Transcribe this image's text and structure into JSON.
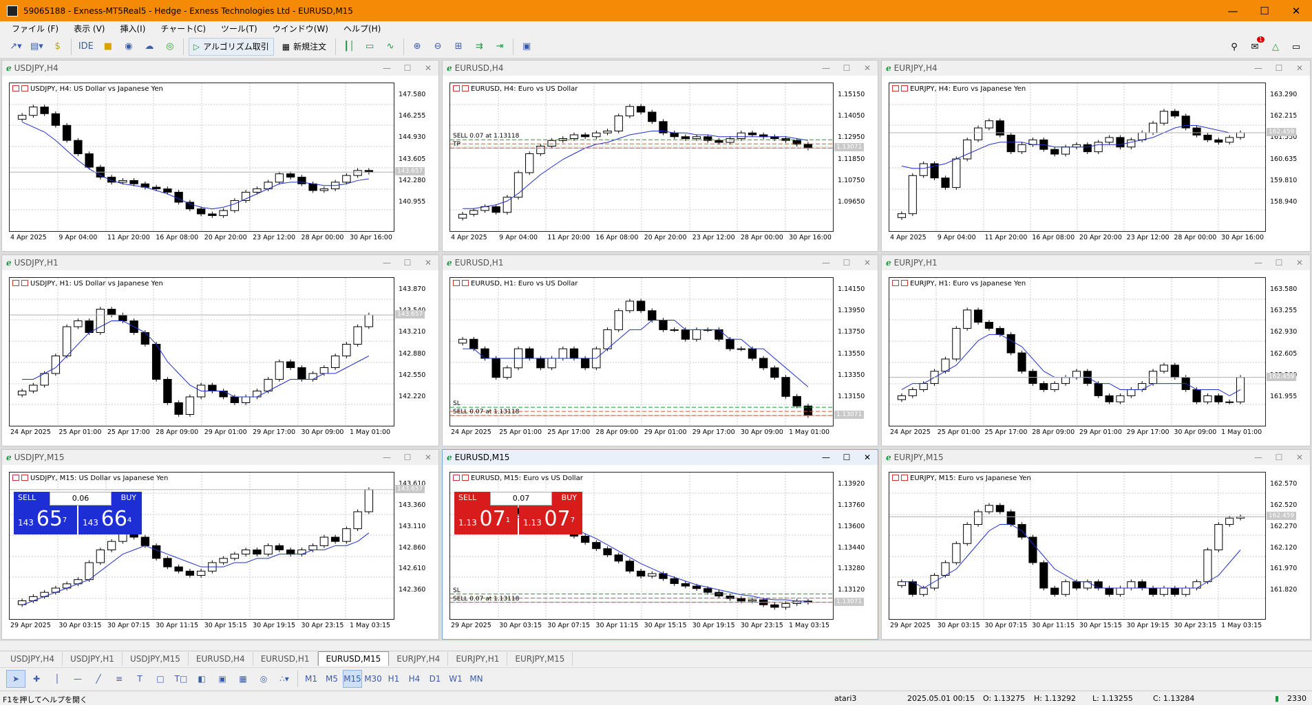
{
  "app": {
    "title": "59065188 - Exness-MT5Real5 - Hedge - Exness Technologies Ltd - EURUSD,M15"
  },
  "menu": [
    "ファイル (F)",
    "表示 (V)",
    "挿入(I)",
    "チャート(C)",
    "ツール(T)",
    "ウインドウ(W)",
    "ヘルプ(H)"
  ],
  "toolbar": {
    "ide": "IDE",
    "algo": "アルゴリズム取引",
    "new_order": "新規注文",
    "badge": "1"
  },
  "charts": [
    {
      "id": "usdjpy-h4",
      "title": "USDJPY,H4",
      "label": "USDJPY, H4:  US Dollar vs Japanese Yen",
      "y": [
        "147.580",
        "146.255",
        "144.930",
        "143.605",
        "142.280",
        "140.955"
      ],
      "x": [
        "4 Apr 2025",
        "9 Apr 04:00",
        "11 Apr 20:00",
        "16 Apr 08:00",
        "20 Apr 20:00",
        "23 Apr 12:00",
        "28 Apr 00:00",
        "30 Apr 16:00"
      ],
      "tag": "143.657",
      "close": [
        146.9,
        147.4,
        147.0,
        146.3,
        145.4,
        144.6,
        143.8,
        143.2,
        142.9,
        143.0,
        142.8,
        142.6,
        142.5,
        142.3,
        141.7,
        141.3,
        141.0,
        140.9,
        141.2,
        141.8,
        142.3,
        142.5,
        142.9,
        143.4,
        143.2,
        142.8,
        142.4,
        142.5,
        142.9,
        143.3,
        143.6,
        143.5
      ],
      "ma": [
        146.5,
        146.2,
        145.9,
        145.4,
        144.8,
        144.2,
        143.7,
        143.3,
        143.0,
        142.8,
        142.7,
        142.6,
        142.4,
        142.2,
        141.9,
        141.6,
        141.4,
        141.3,
        141.4,
        141.6,
        141.9,
        142.2,
        142.5,
        142.8,
        142.9,
        142.9,
        142.8,
        142.7,
        142.7,
        142.8,
        143.0,
        143.1
      ],
      "ymin": 140.3,
      "ymax": 148.0
    },
    {
      "id": "eurusd-h4",
      "title": "EURUSD,H4",
      "label": "EURUSD, H4:  Euro vs US Dollar",
      "y": [
        "1.15150",
        "1.14050",
        "1.12950",
        "1.11850",
        "1.10750",
        "1.09650"
      ],
      "x": [
        "4 Apr 2025",
        "9 Apr 04:00",
        "11 Apr 20:00",
        "16 Apr 08:00",
        "20 Apr 20:00",
        "23 Apr 12:00",
        "28 Apr 00:00",
        "30 Apr 16:00"
      ],
      "tag": "1.13071",
      "trades": [
        "SELL 0.07 at 1.13118",
        "TP"
      ],
      "close": [
        1.096,
        1.098,
        1.1,
        1.097,
        1.105,
        1.118,
        1.128,
        1.132,
        1.135,
        1.136,
        1.138,
        1.137,
        1.139,
        1.14,
        1.148,
        1.153,
        1.15,
        1.145,
        1.139,
        1.137,
        1.136,
        1.137,
        1.135,
        1.134,
        1.136,
        1.139,
        1.138,
        1.137,
        1.136,
        1.135,
        1.133,
        1.131
      ],
      "ma": [
        1.099,
        1.099,
        1.1,
        1.101,
        1.103,
        1.107,
        1.112,
        1.117,
        1.121,
        1.125,
        1.128,
        1.131,
        1.133,
        1.134,
        1.136,
        1.138,
        1.139,
        1.14,
        1.14,
        1.139,
        1.139,
        1.138,
        1.138,
        1.137,
        1.137,
        1.137,
        1.137,
        1.137,
        1.137,
        1.137,
        1.136,
        1.135
      ],
      "ymin": 1.09,
      "ymax": 1.158
    },
    {
      "id": "eurjpy-h4",
      "title": "EURJPY,H4",
      "label": "EURJPY, H4:  Euro vs Japanese Yen",
      "y": [
        "163.290",
        "162.215",
        "161.550",
        "160.635",
        "159.810",
        "158.940"
      ],
      "x": [
        "4 Apr 2025",
        "9 Apr 04:00",
        "11 Apr 20:00",
        "16 Apr 08:00",
        "20 Apr 20:00",
        "23 Apr 12:00",
        "28 Apr 00:00",
        "30 Apr 16:00"
      ],
      "tag": "162.459",
      "close": [
        158.9,
        160.5,
        161.0,
        160.4,
        160.0,
        161.2,
        162.0,
        162.5,
        162.8,
        162.2,
        161.5,
        161.8,
        162.0,
        161.6,
        161.4,
        161.7,
        161.8,
        161.5,
        161.9,
        162.1,
        161.7,
        162.0,
        162.3,
        162.7,
        163.2,
        163.0,
        162.5,
        162.2,
        162.0,
        161.9,
        162.1,
        162.3
      ],
      "ma": [
        160.9,
        160.8,
        160.8,
        160.9,
        161.0,
        161.2,
        161.4,
        161.6,
        161.8,
        161.9,
        161.9,
        161.9,
        161.8,
        161.8,
        161.7,
        161.7,
        161.7,
        161.7,
        161.8,
        161.8,
        161.8,
        161.9,
        162.0,
        162.1,
        162.3,
        162.5,
        162.6,
        162.6,
        162.5,
        162.4,
        162.3,
        162.3
      ],
      "ymin": 158.4,
      "ymax": 163.8
    },
    {
      "id": "usdjpy-h1",
      "title": "USDJPY,H1",
      "label": "USDJPY, H1:  US Dollar vs Japanese Yen",
      "y": [
        "143.870",
        "143.540",
        "143.210",
        "142.880",
        "142.550",
        "142.220"
      ],
      "x": [
        "24 Apr 2025",
        "25 Apr 01:00",
        "25 Apr 17:00",
        "28 Apr 09:00",
        "29 Apr 01:00",
        "29 Apr 17:00",
        "30 Apr 09:00",
        "1 May 01:00"
      ],
      "tag": "143.657",
      "close": [
        142.4,
        142.5,
        142.7,
        143.0,
        143.5,
        143.6,
        143.4,
        143.8,
        143.7,
        143.6,
        143.4,
        143.2,
        142.6,
        142.2,
        142.0,
        142.3,
        142.5,
        142.4,
        142.3,
        142.2,
        142.3,
        142.4,
        142.6,
        142.9,
        142.8,
        142.6,
        142.7,
        142.8,
        143.0,
        143.2,
        143.5,
        143.7
      ],
      "ma": [
        142.6,
        142.6,
        142.7,
        142.8,
        143.0,
        143.2,
        143.4,
        143.5,
        143.6,
        143.6,
        143.5,
        143.4,
        143.2,
        142.9,
        142.7,
        142.5,
        142.4,
        142.4,
        142.4,
        142.3,
        142.3,
        142.3,
        142.4,
        142.5,
        142.6,
        142.6,
        142.6,
        142.7,
        142.7,
        142.8,
        142.9,
        143.0
      ],
      "ymin": 141.9,
      "ymax": 144.1
    },
    {
      "id": "eurusd-h1",
      "title": "EURUSD,H1",
      "label": "EURUSD, H1:  Euro vs US Dollar",
      "y": [
        "1.14150",
        "1.13950",
        "1.13750",
        "1.13550",
        "1.13350",
        "1.13150"
      ],
      "x": [
        "24 Apr 2025",
        "25 Apr 01:00",
        "25 Apr 17:00",
        "28 Apr 09:00",
        "29 Apr 01:00",
        "29 Apr 17:00",
        "30 Apr 09:00",
        "1 May 01:00"
      ],
      "tag": "1.13071",
      "trades": [
        "SL",
        "SELL 0.07 at 1.13118"
      ],
      "close": [
        1.138,
        1.137,
        1.136,
        1.134,
        1.135,
        1.137,
        1.136,
        1.135,
        1.136,
        1.137,
        1.136,
        1.135,
        1.137,
        1.139,
        1.141,
        1.142,
        1.141,
        1.14,
        1.139,
        1.139,
        1.138,
        1.139,
        1.139,
        1.138,
        1.137,
        1.137,
        1.136,
        1.135,
        1.134,
        1.132,
        1.131,
        1.13
      ],
      "ma": [
        1.137,
        1.137,
        1.136,
        1.136,
        1.136,
        1.136,
        1.136,
        1.136,
        1.136,
        1.136,
        1.136,
        1.136,
        1.136,
        1.137,
        1.138,
        1.139,
        1.139,
        1.14,
        1.14,
        1.14,
        1.139,
        1.139,
        1.139,
        1.139,
        1.138,
        1.138,
        1.137,
        1.137,
        1.136,
        1.135,
        1.134,
        1.133
      ],
      "ymin": 1.1295,
      "ymax": 1.143
    },
    {
      "id": "eurjpy-h1",
      "title": "EURJPY,H1",
      "label": "EURJPY, H1:  Euro vs Japanese Yen",
      "y": [
        "163.580",
        "163.255",
        "162.930",
        "162.605",
        "162.280",
        "161.955"
      ],
      "x": [
        "24 Apr 2025",
        "25 Apr 01:00",
        "25 Apr 17:00",
        "28 Apr 09:00",
        "29 Apr 01:00",
        "29 Apr 17:00",
        "30 Apr 09:00",
        "1 May 01:00"
      ],
      "tag": "162.459",
      "close": [
        162.1,
        162.2,
        162.3,
        162.5,
        162.7,
        163.2,
        163.5,
        163.3,
        163.2,
        163.1,
        162.8,
        162.5,
        162.3,
        162.2,
        162.3,
        162.4,
        162.5,
        162.3,
        162.1,
        162.0,
        162.1,
        162.2,
        162.3,
        162.5,
        162.6,
        162.4,
        162.2,
        162.0,
        162.1,
        162.0,
        162.0,
        162.4
      ],
      "ma": [
        162.2,
        162.3,
        162.3,
        162.4,
        162.5,
        162.6,
        162.8,
        163.0,
        163.1,
        163.1,
        163.0,
        162.9,
        162.7,
        162.5,
        162.4,
        162.4,
        162.4,
        162.4,
        162.3,
        162.3,
        162.2,
        162.2,
        162.2,
        162.3,
        162.3,
        162.3,
        162.3,
        162.2,
        162.2,
        162.2,
        162.1,
        162.2
      ],
      "ymin": 161.7,
      "ymax": 163.8
    },
    {
      "id": "usdjpy-m15",
      "title": "USDJPY,M15",
      "label": "USDJPY, M15:  US Dollar vs Japanese Yen",
      "y": [
        "143.610",
        "143.360",
        "143.110",
        "142.860",
        "142.610",
        "142.360"
      ],
      "x": [
        "29 Apr 2025",
        "30 Apr 03:15",
        "30 Apr 07:15",
        "30 Apr 11:15",
        "30 Apr 15:15",
        "30 Apr 19:15",
        "30 Apr 23:15",
        "1 May 03:15"
      ],
      "tag": "143.657",
      "oneclick": {
        "sell": "SELL",
        "buy": "BUY",
        "vol": "0.06",
        "bid_big": "143",
        "bid": "65",
        "bid_pip": "7",
        "ask_big": "143",
        "ask": "66",
        "ask_pip": "4",
        "color": "#1d2fd4"
      },
      "close": [
        142.35,
        142.4,
        142.45,
        142.5,
        142.55,
        142.6,
        142.8,
        142.95,
        143.05,
        143.15,
        143.1,
        143.0,
        142.85,
        142.75,
        142.7,
        142.65,
        142.7,
        142.8,
        142.85,
        142.9,
        142.95,
        142.9,
        143.0,
        142.95,
        142.9,
        142.95,
        143.0,
        143.1,
        143.05,
        143.2,
        143.4,
        143.66
      ],
      "ma": [
        142.3,
        142.35,
        142.4,
        142.45,
        142.5,
        142.55,
        142.6,
        142.7,
        142.8,
        142.9,
        142.95,
        143.0,
        142.95,
        142.9,
        142.85,
        142.8,
        142.75,
        142.75,
        142.75,
        142.8,
        142.8,
        142.85,
        142.85,
        142.9,
        142.9,
        142.9,
        142.95,
        142.95,
        143.0,
        143.0,
        143.05,
        143.15
      ],
      "ymin": 142.2,
      "ymax": 143.7
    },
    {
      "id": "eurusd-m15",
      "title": "EURUSD,M15",
      "label": "EURUSD, M15:  Euro vs US Dollar",
      "y": [
        "1.13920",
        "1.13760",
        "1.13600",
        "1.13440",
        "1.13280",
        "1.13120"
      ],
      "x": [
        "29 Apr 2025",
        "30 Apr 03:15",
        "30 Apr 07:15",
        "30 Apr 11:15",
        "30 Apr 15:15",
        "30 Apr 19:15",
        "30 Apr 23:15",
        "1 May 03:15"
      ],
      "tag": "1.13071",
      "trades": [
        "SL",
        "SELL 0.07 at 1.13118"
      ],
      "oneclick": {
        "sell": "SELL",
        "buy": "BUY",
        "vol": "0.07",
        "bid_big": "1.13",
        "bid": "07",
        "bid_pip": "1",
        "ask_big": "1.13",
        "ask": "07",
        "ask_pip": "7",
        "color": "#d81c1c"
      },
      "close": [
        1.137,
        1.1368,
        1.1375,
        1.138,
        1.1382,
        1.1378,
        1.1374,
        1.1376,
        1.1372,
        1.1365,
        1.136,
        1.1355,
        1.135,
        1.1345,
        1.134,
        1.1332,
        1.1328,
        1.133,
        1.1326,
        1.1322,
        1.132,
        1.1318,
        1.1315,
        1.1312,
        1.131,
        1.1308,
        1.1309,
        1.1305,
        1.1303,
        1.1306,
        1.1308,
        1.1307
      ],
      "ma": [
        1.138,
        1.1378,
        1.1377,
        1.1376,
        1.1376,
        1.1375,
        1.1374,
        1.1373,
        1.1372,
        1.1369,
        1.1366,
        1.1362,
        1.1358,
        1.1353,
        1.1348,
        1.1343,
        1.1338,
        1.1334,
        1.133,
        1.1327,
        1.1324,
        1.1321,
        1.1319,
        1.1317,
        1.1315,
        1.1313,
        1.1312,
        1.131,
        1.1309,
        1.1309,
        1.1308,
        1.1308
      ],
      "ymin": 1.1298,
      "ymax": 1.14
    },
    {
      "id": "eurjpy-m15",
      "title": "EURJPY,M15",
      "label": "EURJPY, M15:  Euro vs Japanese Yen",
      "y": [
        "162.570",
        "162.520",
        "162.270",
        "162.120",
        "161.970",
        "161.820"
      ],
      "x": [
        "29 Apr 2025",
        "30 Apr 03:15",
        "30 Apr 07:15",
        "30 Apr 11:15",
        "30 Apr 15:15",
        "30 Apr 19:15",
        "30 Apr 23:15",
        "1 May 03:15"
      ],
      "tag": "162.459",
      "close": [
        161.95,
        161.85,
        161.9,
        162.0,
        162.1,
        162.25,
        162.4,
        162.5,
        162.55,
        162.5,
        162.4,
        162.3,
        162.1,
        161.9,
        161.85,
        161.95,
        161.9,
        161.95,
        161.9,
        161.85,
        161.9,
        161.95,
        161.9,
        161.85,
        161.9,
        161.85,
        161.9,
        161.95,
        162.2,
        162.4,
        162.45,
        162.46
      ],
      "ma": [
        161.95,
        161.95,
        161.9,
        161.95,
        162.0,
        162.05,
        162.15,
        162.25,
        162.35,
        162.4,
        162.4,
        162.35,
        162.25,
        162.15,
        162.05,
        162.0,
        161.95,
        161.95,
        161.9,
        161.9,
        161.9,
        161.9,
        161.9,
        161.9,
        161.9,
        161.9,
        161.9,
        161.9,
        161.95,
        162.0,
        162.1,
        162.2
      ],
      "ymin": 161.7,
      "ymax": 162.7
    }
  ],
  "tabs": [
    "USDJPY,H4",
    "USDJPY,H1",
    "USDJPY,M15",
    "EURUSD,H4",
    "EURUSD,H1",
    "EURUSD,M15",
    "EURJPY,H4",
    "EURJPY,H1",
    "EURJPY,M15"
  ],
  "active_tab": "EURUSD,M15",
  "timeframes": [
    "M1",
    "M5",
    "M15",
    "M30",
    "H1",
    "H4",
    "D1",
    "W1",
    "MN"
  ],
  "active_tf": "M15",
  "status": {
    "help": "F1を押してヘルプを開く",
    "profile": "atari3",
    "datetime": "2025.05.01 00:15",
    "open": "O: 1.13275",
    "high": "H: 1.13292",
    "low": "L: 1.13255",
    "close": "C: 1.13284",
    "ping": "2330"
  }
}
